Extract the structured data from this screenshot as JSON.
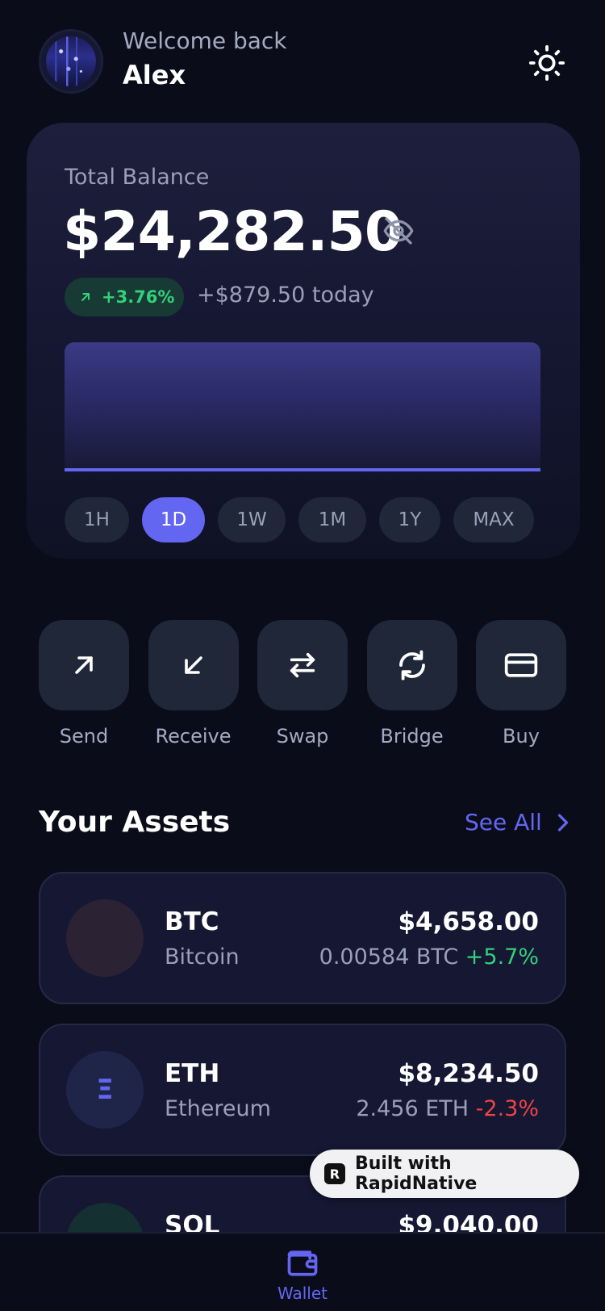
{
  "header": {
    "welcome": "Welcome back",
    "username": "Alex"
  },
  "balance": {
    "label": "Total Balance",
    "value": "$24,282.50",
    "change_pct": "+3.76%",
    "change_today": "+$879.50 today"
  },
  "ranges": {
    "items": [
      "1H",
      "1D",
      "1W",
      "1M",
      "1Y",
      "MAX"
    ],
    "selected": "1D"
  },
  "actions": {
    "send": "Send",
    "receive": "Receive",
    "swap": "Swap",
    "bridge": "Bridge",
    "buy": "Buy"
  },
  "assets": {
    "title": "Your Assets",
    "see_all": "See All",
    "items": [
      {
        "symbol": "BTC",
        "name": "Bitcoin",
        "value": "$4,658.00",
        "amount": "0.00584 BTC",
        "change": "+5.7%",
        "icon_glyph": ""
      },
      {
        "symbol": "ETH",
        "name": "Ethereum",
        "value": "$8,234.50",
        "amount": "2.456 ETH",
        "change": "-2.3%",
        "icon_glyph": "Ξ"
      },
      {
        "symbol": "SOL",
        "name": "",
        "value": "$9,040.00",
        "amount": "",
        "change": "",
        "icon_glyph": ""
      }
    ]
  },
  "badge": {
    "text": "Built with RapidNative",
    "logo": "R"
  },
  "nav": {
    "wallet": "Wallet"
  },
  "colors": {
    "background": "#0b0c1a",
    "accent": "#6366f1",
    "positive": "#34d07a",
    "negative": "#ef4444"
  },
  "icons": {
    "theme": "sun-icon",
    "hide_balance": "eye-off-icon",
    "send": "arrow-up-right-icon",
    "receive": "arrow-down-left-icon",
    "swap": "swap-arrows-icon",
    "bridge": "refresh-icon",
    "buy": "credit-card-icon",
    "see_all": "chevron-right-icon",
    "wallet": "wallet-icon"
  }
}
